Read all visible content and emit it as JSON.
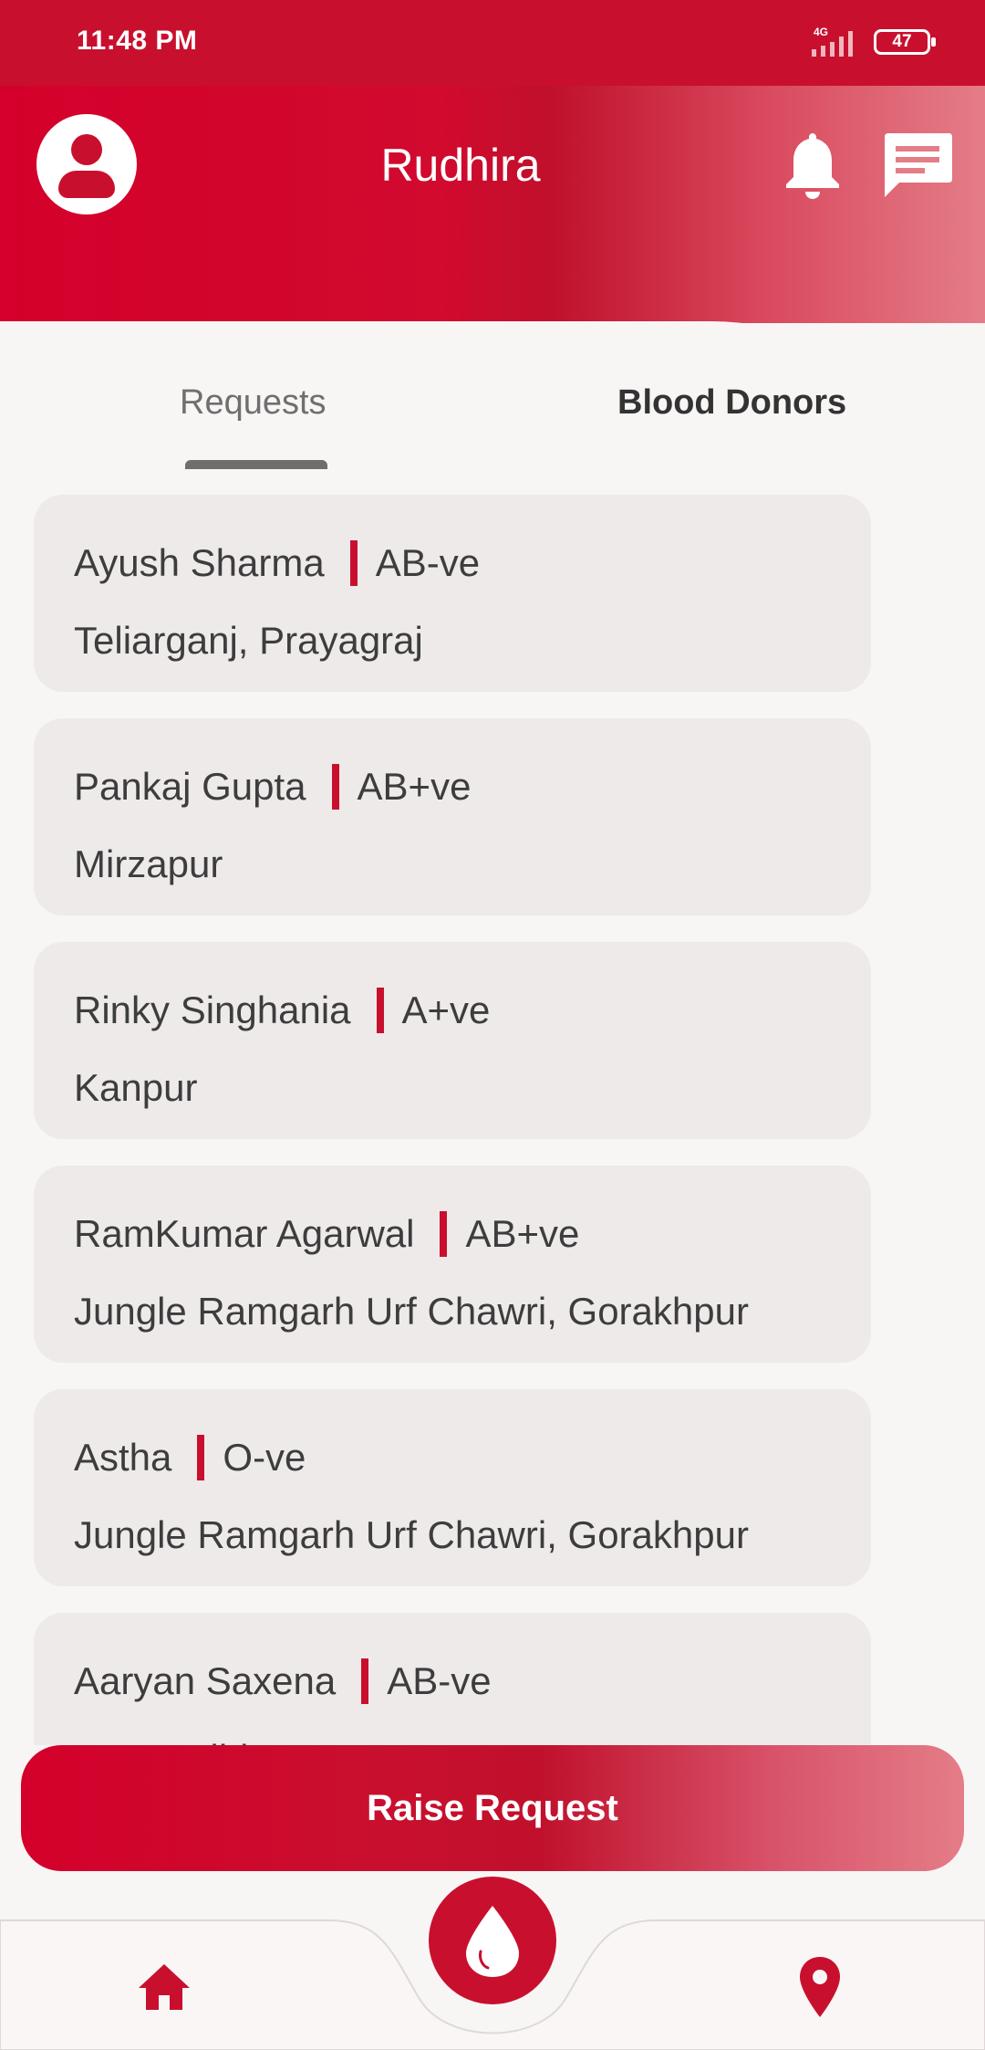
{
  "status_bar": {
    "time": "11:48 PM",
    "network": "4G",
    "battery": "47"
  },
  "header": {
    "title": "Rudhira",
    "profile_icon": "profile-icon",
    "notification_icon": "bell-icon",
    "chat_icon": "chat-icon"
  },
  "tabs": [
    {
      "label": "Requests",
      "active": true
    },
    {
      "label": "Blood Donors",
      "active": false
    }
  ],
  "requests": [
    {
      "name": "Ayush Sharma",
      "blood_group": "AB-ve",
      "location": "Teliarganj, Prayagraj"
    },
    {
      "name": "Pankaj Gupta",
      "blood_group": "AB+ve",
      "location": "Mirzapur"
    },
    {
      "name": "Rinky Singhania",
      "blood_group": "A+ve",
      "location": "Kanpur"
    },
    {
      "name": "RamKumar Agarwal",
      "blood_group": "AB+ve",
      "location": "Jungle Ramgarh Urf Chawri, Gorakhpur"
    },
    {
      "name": "Astha",
      "blood_group": "O-ve",
      "location": "Jungle Ramgarh Urf Chawri, Gorakhpur"
    },
    {
      "name": "Aaryan Saxena",
      "blood_group": "AB-ve",
      "location": "New Delhi"
    }
  ],
  "actions": {
    "raise_request_label": "Raise Request"
  },
  "bottom_nav": {
    "home_icon": "home-icon",
    "center_icon": "blood-drop-icon",
    "location_icon": "location-pin-icon"
  },
  "colors": {
    "accent": "#c8102e",
    "card": "#efeaea",
    "background": "#f8f5f5"
  }
}
